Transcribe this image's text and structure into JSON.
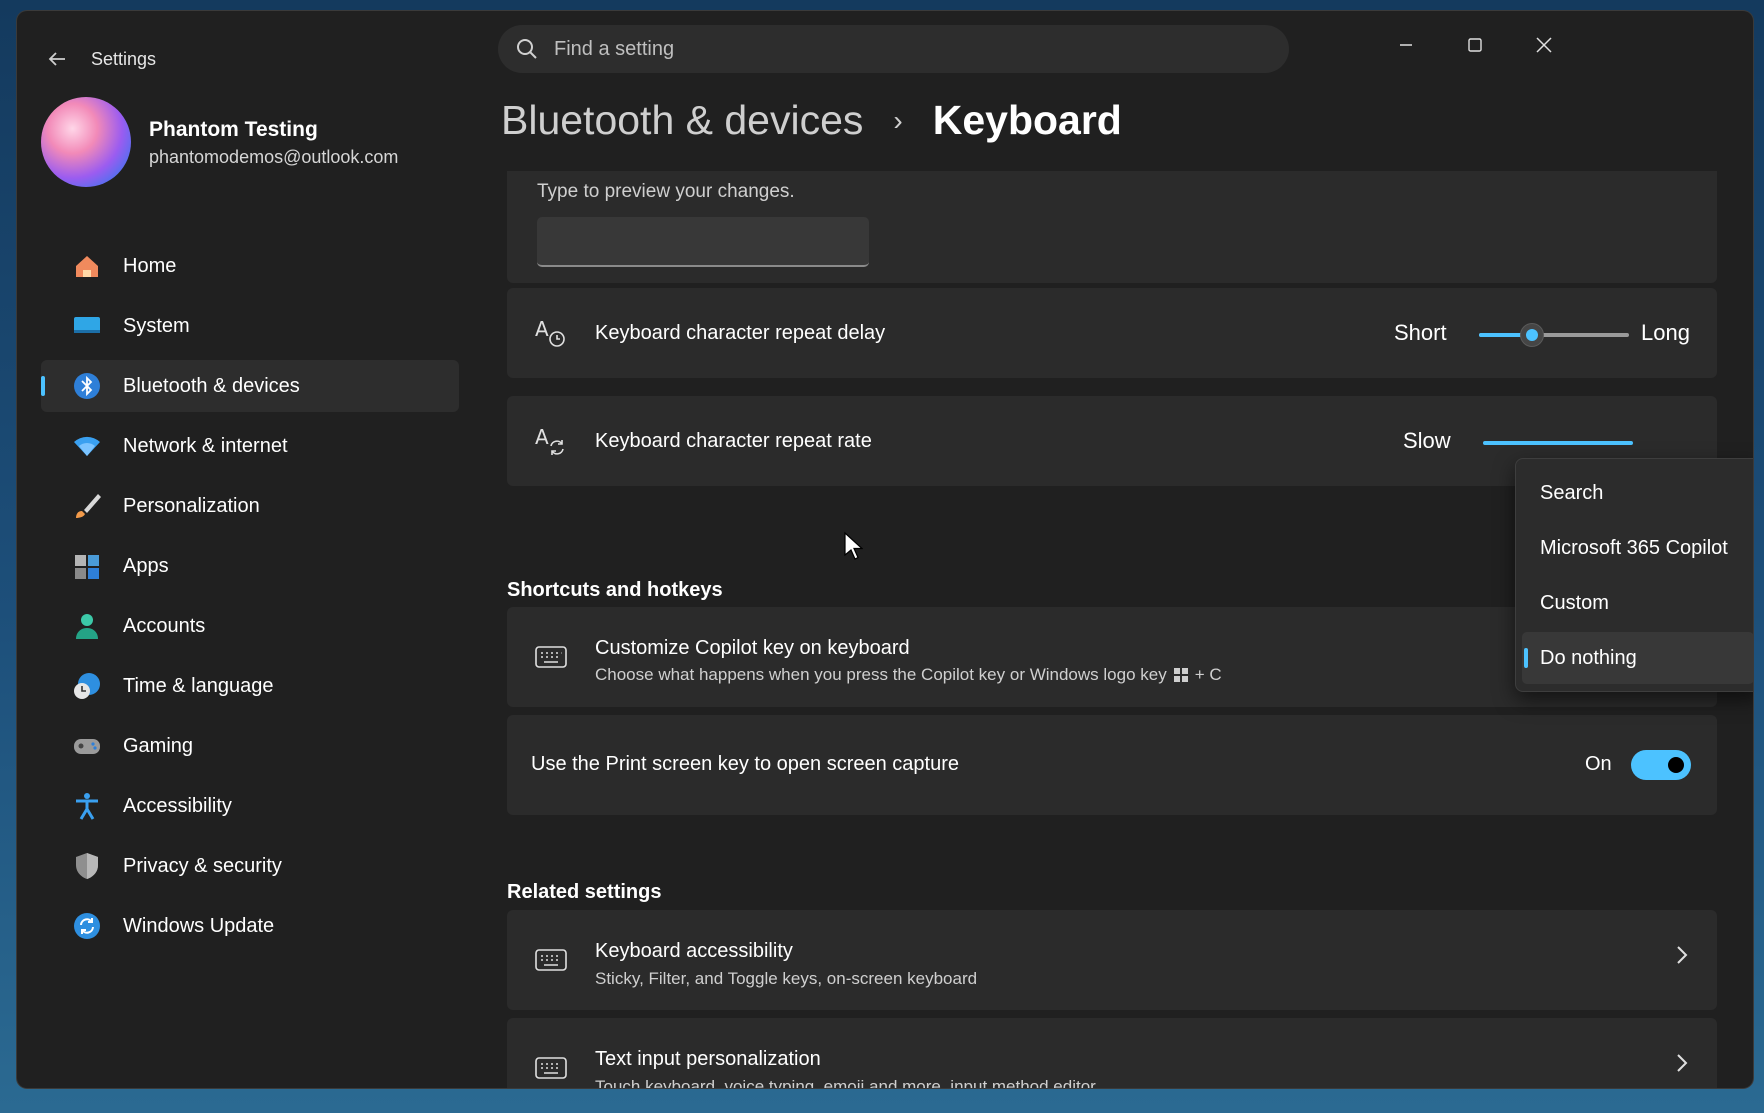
{
  "window": {
    "app_title": "Settings",
    "search_placeholder": "Find a setting"
  },
  "profile": {
    "name": "Phantom Testing",
    "email": "phantomodemos@outlook.com"
  },
  "sidebar": {
    "items": [
      {
        "label": "Home",
        "icon": "home-icon"
      },
      {
        "label": "System",
        "icon": "system-icon"
      },
      {
        "label": "Bluetooth & devices",
        "icon": "bluetooth-icon",
        "active": true
      },
      {
        "label": "Network & internet",
        "icon": "wifi-icon"
      },
      {
        "label": "Personalization",
        "icon": "brush-icon"
      },
      {
        "label": "Apps",
        "icon": "apps-icon"
      },
      {
        "label": "Accounts",
        "icon": "accounts-icon"
      },
      {
        "label": "Time & language",
        "icon": "clock-globe-icon"
      },
      {
        "label": "Gaming",
        "icon": "gamepad-icon"
      },
      {
        "label": "Accessibility",
        "icon": "accessibility-icon"
      },
      {
        "label": "Privacy & security",
        "icon": "shield-icon"
      },
      {
        "label": "Windows Update",
        "icon": "update-icon"
      }
    ]
  },
  "breadcrumb": {
    "parent": "Bluetooth & devices",
    "separator": "›",
    "current": "Keyboard"
  },
  "preview": {
    "label": "Type to preview your changes.",
    "value": ""
  },
  "repeat_delay": {
    "title": "Keyboard character repeat delay",
    "min_label": "Short",
    "max_label": "Long",
    "value_fraction": 0.35
  },
  "repeat_rate": {
    "title": "Keyboard character repeat rate",
    "min_label": "Slow"
  },
  "shortcuts": {
    "section_title": "Shortcuts and hotkeys",
    "copilot": {
      "title": "Customize Copilot key on keyboard",
      "subtitle_before": "Choose what happens when you press the Copilot key or Windows logo key",
      "subtitle_after": "+ C"
    },
    "print_screen": {
      "title": "Use the Print screen key to open screen capture",
      "state_label": "On",
      "on": true
    }
  },
  "related": {
    "section_title": "Related settings",
    "items": [
      {
        "title": "Keyboard accessibility",
        "subtitle": "Sticky, Filter, and Toggle keys, on-screen keyboard"
      },
      {
        "title": "Text input personalization",
        "subtitle": "Touch keyboard, voice typing, emoji and more, input method editor"
      }
    ]
  },
  "copilot_menu": {
    "options": [
      "Search",
      "Microsoft 365 Copilot",
      "Custom",
      "Do nothing"
    ],
    "selected": "Do nothing"
  },
  "colors": {
    "accent": "#4cc2ff",
    "window_bg": "#202020",
    "card_bg": "#2b2b2b"
  }
}
